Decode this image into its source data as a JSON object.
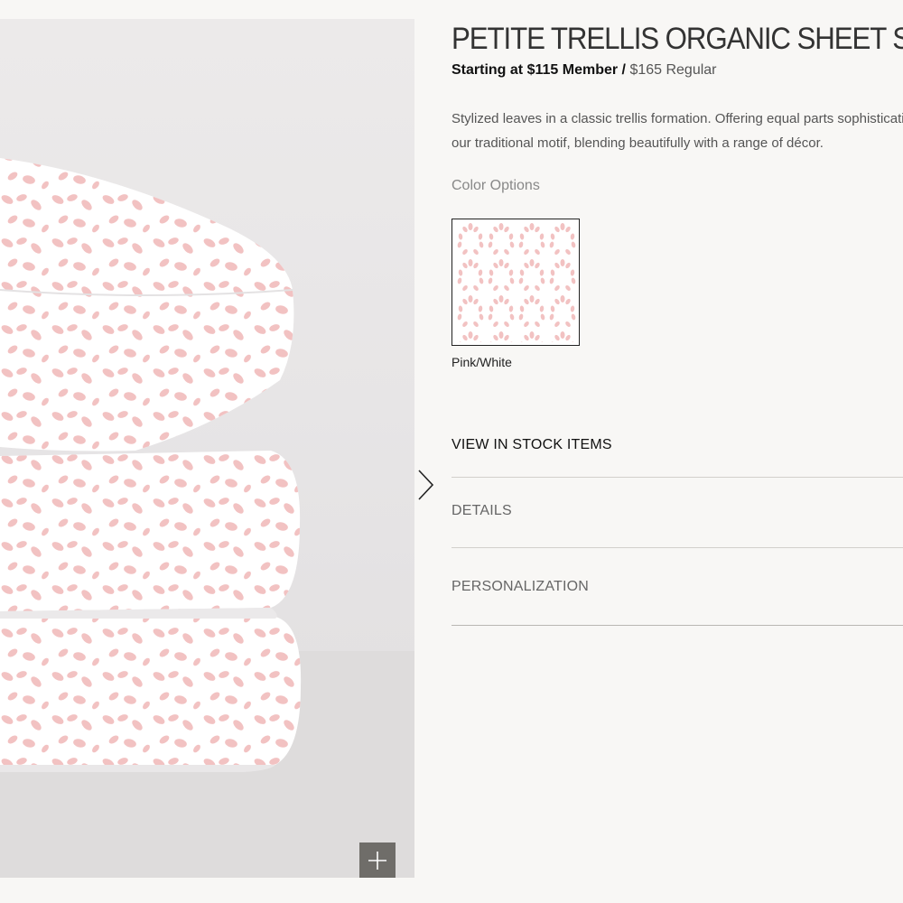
{
  "product": {
    "title": "PETITE TRELLIS ORGANIC SHEET SET",
    "price_prefix": "Starting at",
    "member_price": "$115 Member",
    "separator": " / ",
    "regular_price": "$165 Regular",
    "description": "Stylized leaves in a classic trellis formation. Offering equal parts sophistication and charm, our traditional motif, blending beautifully with a range of décor."
  },
  "colors": {
    "label": "Color Options",
    "options": [
      {
        "name": "Pink/White",
        "selected": true,
        "swatch_color": "#f2c2c2"
      }
    ]
  },
  "accordion": {
    "stock_label": "VIEW IN STOCK ITEMS",
    "details_label": "DETAILS",
    "personalization_label": "PERSONALIZATION"
  },
  "gallery": {
    "zoom_icon": "plus-icon",
    "next_icon": "chevron-right-icon"
  },
  "theme": {
    "background": "#f8f7f5",
    "pattern_pink": "#f2c2c2",
    "zoom_button": "#6f6d69"
  }
}
